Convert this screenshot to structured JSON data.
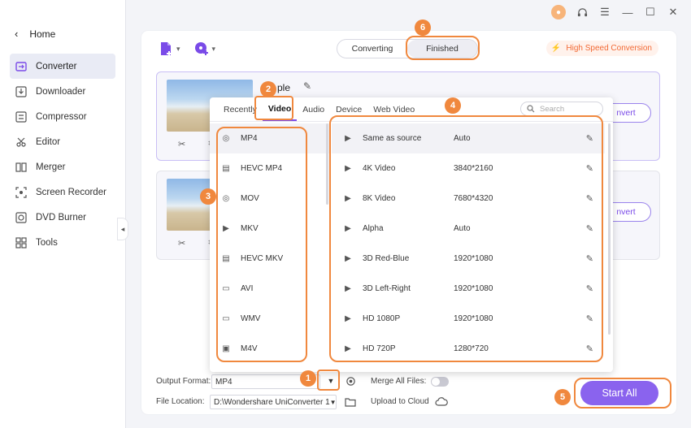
{
  "sidebar": {
    "home_label": "Home",
    "items": [
      {
        "label": "Converter",
        "icon": "converter-icon"
      },
      {
        "label": "Downloader",
        "icon": "downloader-icon"
      },
      {
        "label": "Compressor",
        "icon": "compressor-icon"
      },
      {
        "label": "Editor",
        "icon": "editor-icon"
      },
      {
        "label": "Merger",
        "icon": "merger-icon"
      },
      {
        "label": "Screen Recorder",
        "icon": "screen-recorder-icon"
      },
      {
        "label": "DVD Burner",
        "icon": "dvd-burner-icon"
      },
      {
        "label": "Tools",
        "icon": "tools-icon"
      }
    ]
  },
  "header": {
    "tabs": {
      "converting": "Converting",
      "finished": "Finished"
    },
    "high_speed": "High Speed Conversion"
  },
  "cards": [
    {
      "title_fragment": "ple",
      "convert_fragment": "nvert"
    },
    {
      "convert_fragment": "nvert"
    }
  ],
  "popup": {
    "tabs": [
      "Recently",
      "Video",
      "Audio",
      "Device",
      "Web Video"
    ],
    "search_placeholder": "Search",
    "formats": [
      "MP4",
      "HEVC MP4",
      "MOV",
      "MKV",
      "HEVC MKV",
      "AVI",
      "WMV",
      "M4V"
    ],
    "presets": [
      {
        "name": "Same as source",
        "res": "Auto"
      },
      {
        "name": "4K Video",
        "res": "3840*2160"
      },
      {
        "name": "8K Video",
        "res": "7680*4320"
      },
      {
        "name": "Alpha",
        "res": "Auto"
      },
      {
        "name": "3D Red-Blue",
        "res": "1920*1080"
      },
      {
        "name": "3D Left-Right",
        "res": "1920*1080"
      },
      {
        "name": "HD 1080P",
        "res": "1920*1080"
      },
      {
        "name": "HD 720P",
        "res": "1280*720"
      }
    ]
  },
  "bottom": {
    "output_format_label": "Output Format:",
    "output_format_value": "MP4",
    "merge_label": "Merge All Files:",
    "file_location_label": "File Location:",
    "file_location_value": "D:\\Wondershare UniConverter 1",
    "upload_label": "Upload to Cloud",
    "start_all": "Start All"
  },
  "annotations": [
    "1",
    "2",
    "3",
    "4",
    "5",
    "6"
  ],
  "colors": {
    "accent": "#7a4be8",
    "annotation": "#f0883e",
    "high_speed": "#f26a35"
  }
}
